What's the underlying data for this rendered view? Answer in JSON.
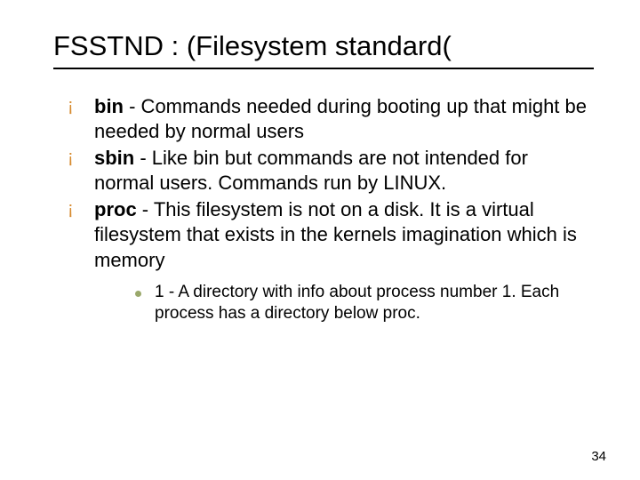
{
  "title": "FSSTND : (Filesystem standard(",
  "bullets": [
    {
      "term": "bin",
      "text": " - Commands needed during booting up that might be needed by normal users"
    },
    {
      "term": "sbin",
      "text": " - Like bin but commands are not intended for normal users. Commands run by LINUX."
    },
    {
      "term": "proc",
      "text": " - This filesystem is not on a disk. It is a virtual filesystem that exists in the kernels imagination which is memory"
    }
  ],
  "sub": [
    {
      "text": "1 - A directory with info about process number 1. Each process has a directory below proc."
    }
  ],
  "page": "34"
}
